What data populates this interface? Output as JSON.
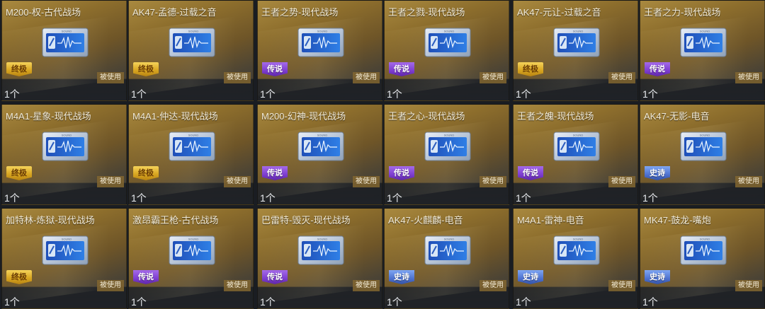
{
  "used_label": "被使用",
  "badge_colors": {
    "gold": "#d9a722",
    "purple": "#7d3dd0",
    "blue": "#4e72d0"
  },
  "icon": "sound-card-icon",
  "cards": [
    {
      "title": "M200-权-古代战场",
      "badge": "终极",
      "rarity": "gold",
      "count": "1个"
    },
    {
      "title": "AK47-孟德-过载之音",
      "badge": "终极",
      "rarity": "gold",
      "count": "1个"
    },
    {
      "title": "王者之势-现代战场",
      "badge": "传说",
      "rarity": "purple",
      "count": "1个"
    },
    {
      "title": "王者之戮-现代战场",
      "badge": "传说",
      "rarity": "purple",
      "count": "1个"
    },
    {
      "title": "AK47-元让-过载之音",
      "badge": "终极",
      "rarity": "gold",
      "count": "1个"
    },
    {
      "title": "王者之力-现代战场",
      "badge": "传说",
      "rarity": "purple",
      "count": "1个"
    },
    {
      "title": "M4A1-星象-现代战场",
      "badge": "终极",
      "rarity": "gold",
      "count": "1个"
    },
    {
      "title": "M4A1-仲达-现代战场",
      "badge": "终极",
      "rarity": "gold",
      "count": "1个"
    },
    {
      "title": "M200-幻神-现代战场",
      "badge": "传说",
      "rarity": "purple",
      "count": "1个"
    },
    {
      "title": "王者之心-现代战场",
      "badge": "传说",
      "rarity": "purple",
      "count": "1个"
    },
    {
      "title": "王者之魄-现代战场",
      "badge": "传说",
      "rarity": "purple",
      "count": "1个"
    },
    {
      "title": "AK47-无影-电音",
      "badge": "史诗",
      "rarity": "blue",
      "count": "1个"
    },
    {
      "title": "加特林-炼狱-现代战场",
      "badge": "终极",
      "rarity": "gold",
      "count": "1个"
    },
    {
      "title": "激昂霸王枪-古代战场",
      "badge": "传说",
      "rarity": "purple",
      "count": "1个"
    },
    {
      "title": "巴雷特-毁灭-现代战场",
      "badge": "传说",
      "rarity": "purple",
      "count": "1个"
    },
    {
      "title": "AK47-火麒麟-电音",
      "badge": "史诗",
      "rarity": "blue",
      "count": "1个"
    },
    {
      "title": "M4A1-雷神-电音",
      "badge": "史诗",
      "rarity": "blue",
      "count": "1个"
    },
    {
      "title": "MK47-鼓龙-嘴炮",
      "badge": "史诗",
      "rarity": "blue",
      "count": "1个"
    }
  ]
}
